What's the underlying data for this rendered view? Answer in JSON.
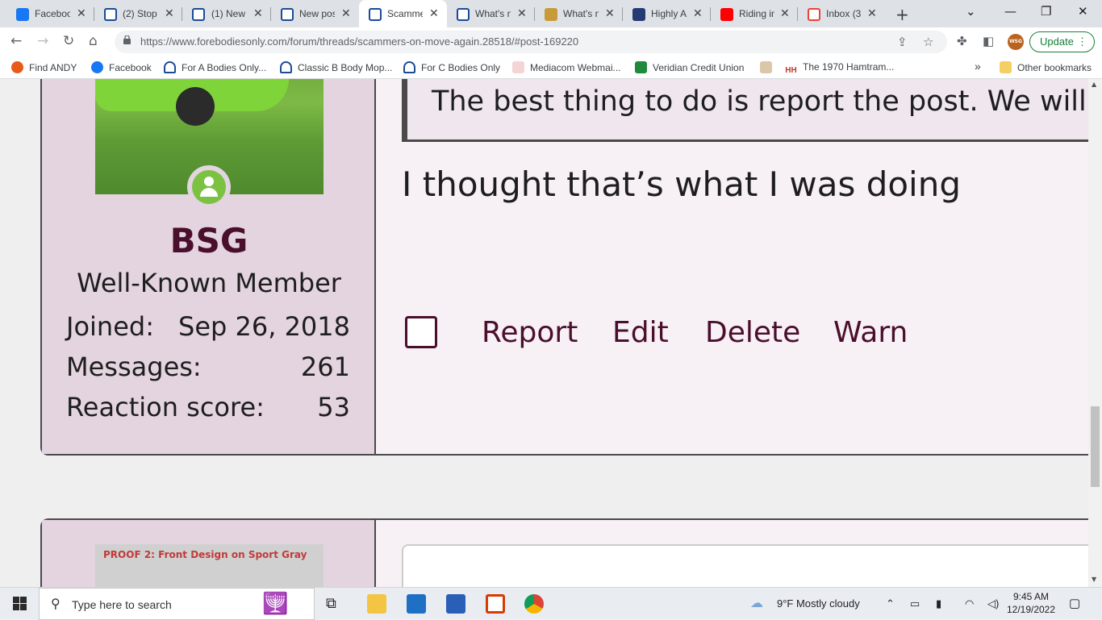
{
  "tabs": [
    {
      "label": "Faceboo",
      "icon": "facebook-icon"
    },
    {
      "label": "(2) Stop",
      "icon": "mopar-icon"
    },
    {
      "label": "(1) New",
      "icon": "mopar-icon"
    },
    {
      "label": "New pos",
      "icon": "mopar-icon"
    },
    {
      "label": "Scamme",
      "icon": "mopar-icon",
      "active": true
    },
    {
      "label": "What's n",
      "icon": "mopar-icon"
    },
    {
      "label": "What's n",
      "icon": "car-icon"
    },
    {
      "label": "Highly A",
      "icon": "highly-icon"
    },
    {
      "label": "Riding in",
      "icon": "youtube-icon"
    },
    {
      "label": "Inbox (3",
      "icon": "gmail-icon"
    }
  ],
  "toolbar": {
    "url": "https://www.forebodiesonly.com/forum/threads/scammers-on-move-again.28518/#post-169220",
    "update_label": "Update",
    "profile_initials": "WSG"
  },
  "bookmarks": [
    {
      "label": "Find ANDY",
      "icon": "flame-icon",
      "color": "#e8591a"
    },
    {
      "label": "Facebook",
      "icon": "facebook-icon",
      "color": "#1877f2"
    },
    {
      "label": "For A Bodies Only...",
      "icon": "mopar-icon",
      "color": "#1a4c96"
    },
    {
      "label": "Classic B Body Mop...",
      "icon": "mopar-icon",
      "color": "#1a4c96"
    },
    {
      "label": "For C Bodies Only",
      "icon": "mopar-icon",
      "color": "#1a4c96"
    },
    {
      "label": "Mediacom Webmai...",
      "icon": "mail-icon",
      "color": "#d04c4c"
    },
    {
      "label": "Veridian Credit Union",
      "icon": "veridian-icon",
      "color": "#1f8a3c"
    },
    {
      "label": "",
      "icon": "tp-icon",
      "color": "#6b4a2a"
    },
    {
      "label": "The 1970 Hamtram...",
      "icon": "hh-icon",
      "color": "#c0392b"
    }
  ],
  "bookmarks_overflow": "»",
  "other_bookmarks": "Other bookmarks",
  "post": {
    "quote_text": "The best thing to do is report the post. We will d",
    "message": "I thought that’s what I was doing",
    "user": {
      "name": "BSG",
      "title": "Well-Known Member",
      "stats": [
        {
          "label": "Joined:",
          "value": "Sep 26, 2018"
        },
        {
          "label": "Messages:",
          "value": "261"
        },
        {
          "label": "Reaction score:",
          "value": "53"
        }
      ]
    },
    "actions": [
      "Report",
      "Edit",
      "Delete",
      "Warn"
    ]
  },
  "post2": {
    "avatar_caption": "PROOF 2: Front Design on Sport Gray"
  },
  "taskbar": {
    "search_placeholder": "Type here to search",
    "weather": "9°F  Mostly cloudy",
    "time": "9:45 AM",
    "date": "12/19/2022"
  },
  "colors": {
    "accent": "#4a0f2c",
    "userpane": "#e3d4e0",
    "online": "#7cc242",
    "update_green": "#188038"
  }
}
